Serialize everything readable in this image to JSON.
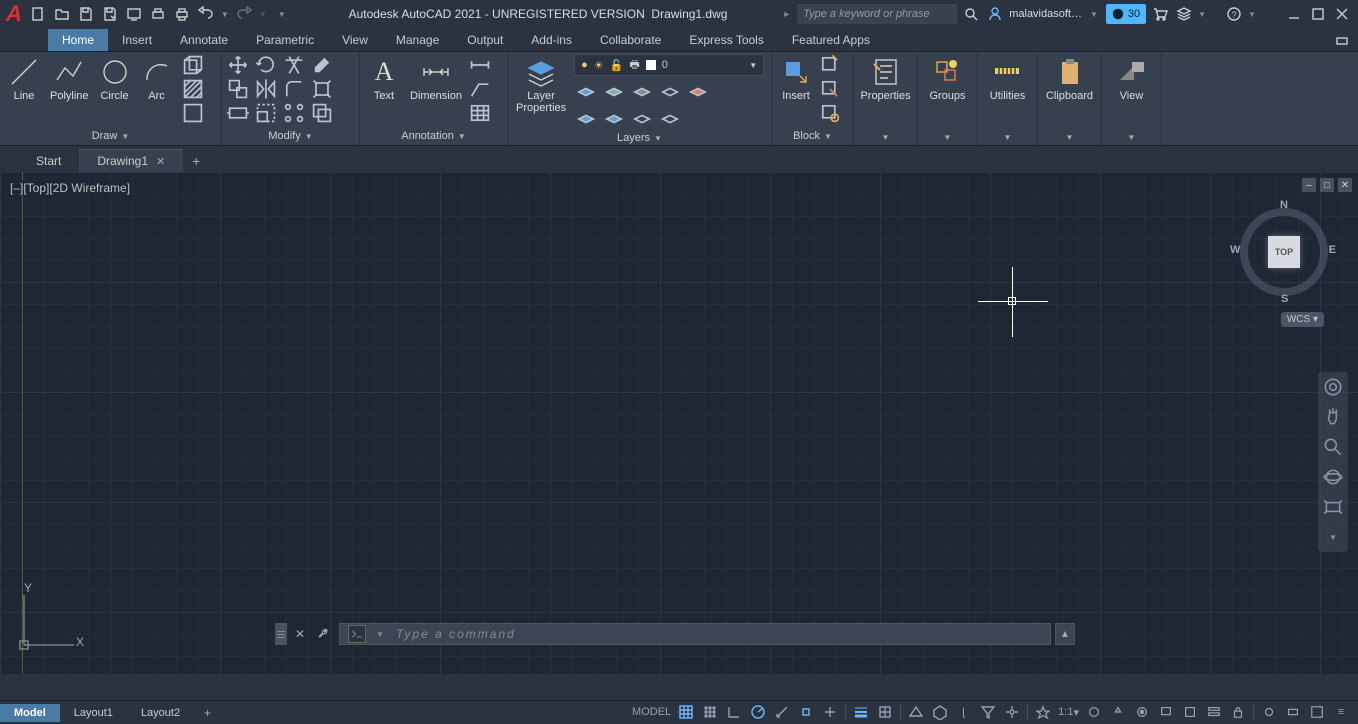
{
  "title": "Autodesk AutoCAD 2021 - UNREGISTERED VERSION",
  "filename": "Drawing1.dwg",
  "search_placeholder": "Type a keyword or phrase",
  "user": "malavidasoft…",
  "trial_days": "30",
  "ribbon_tabs": [
    "Home",
    "Insert",
    "Annotate",
    "Parametric",
    "View",
    "Manage",
    "Output",
    "Add-ins",
    "Collaborate",
    "Express Tools",
    "Featured Apps"
  ],
  "panels": {
    "draw": {
      "title": "Draw",
      "tools": {
        "line": "Line",
        "polyline": "Polyline",
        "circle": "Circle",
        "arc": "Arc"
      }
    },
    "modify": {
      "title": "Modify"
    },
    "annotation": {
      "title": "Annotation",
      "tools": {
        "text": "Text",
        "dimension": "Dimension"
      }
    },
    "layers": {
      "title": "Layers",
      "tools": {
        "props": "Layer\nProperties"
      },
      "current": "0"
    },
    "block": {
      "title": "Block",
      "tools": {
        "insert": "Insert"
      }
    },
    "properties": {
      "title": "Properties"
    },
    "groups": {
      "title": "Groups"
    },
    "utilities": {
      "title": "Utilities"
    },
    "clipboard": {
      "title": "Clipboard"
    },
    "view": {
      "title": "View"
    }
  },
  "file_tabs": {
    "start": "Start",
    "drawing": "Drawing1"
  },
  "viewport_label": "[–][Top][2D Wireframe]",
  "viewcube": {
    "face": "TOP",
    "n": "N",
    "s": "S",
    "e": "E",
    "w": "W"
  },
  "wcs": "WCS",
  "ucs": {
    "x": "X",
    "y": "Y"
  },
  "cmd_placeholder": "Type a command",
  "layout_tabs": [
    "Model",
    "Layout1",
    "Layout2"
  ],
  "status": {
    "model": "MODEL",
    "scale": "1:1"
  }
}
